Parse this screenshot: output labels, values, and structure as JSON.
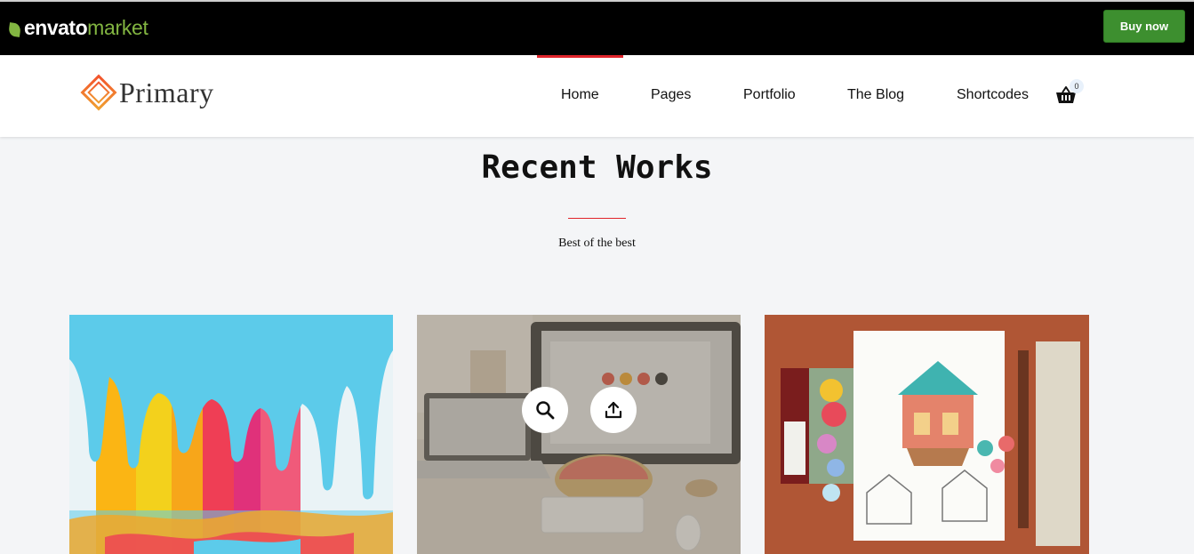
{
  "envato": {
    "brand": "envato",
    "product": "market",
    "buy_label": "Buy now",
    "colors": {
      "bar": "#000000",
      "brand_green": "#82b541",
      "buy_button": "#3d8f2f"
    }
  },
  "site": {
    "logo_text": "Primary",
    "accent_color": "#e0242b",
    "nav": [
      {
        "label": "Home"
      },
      {
        "label": "Pages"
      },
      {
        "label": "Portfolio"
      },
      {
        "label": "The Blog"
      },
      {
        "label": "Shortcodes"
      }
    ],
    "cart": {
      "icon": "basket-icon",
      "count": "0"
    }
  },
  "section": {
    "title": "Recent Works",
    "subtitle": "Best of the best"
  },
  "portfolio": {
    "items": [
      {
        "image": "paint-drip-artwork"
      },
      {
        "image": "desk-workspace-computer",
        "hover": true,
        "actions": [
          "search-icon",
          "share-icon"
        ]
      },
      {
        "image": "sketch-illustration-with-paints"
      }
    ]
  }
}
